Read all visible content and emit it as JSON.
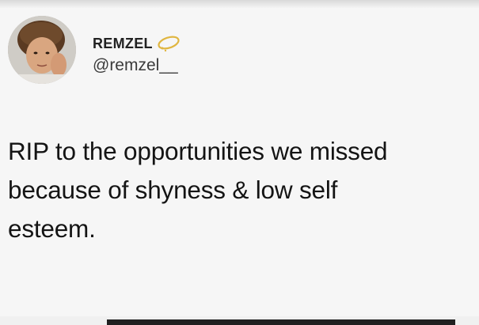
{
  "tweet": {
    "display_name": "REMZEL",
    "handle": "@remzel__",
    "text": "RIP to the opportunities we missed\nbecause of shyness & low self\nesteem.",
    "badge_icon": "halo-icon",
    "avatar_icon": "profile-photo"
  },
  "colors": {
    "background": "#f6f6f6",
    "text": "#141414",
    "handle": "#3b3b3b",
    "halo": "#e0b640"
  }
}
